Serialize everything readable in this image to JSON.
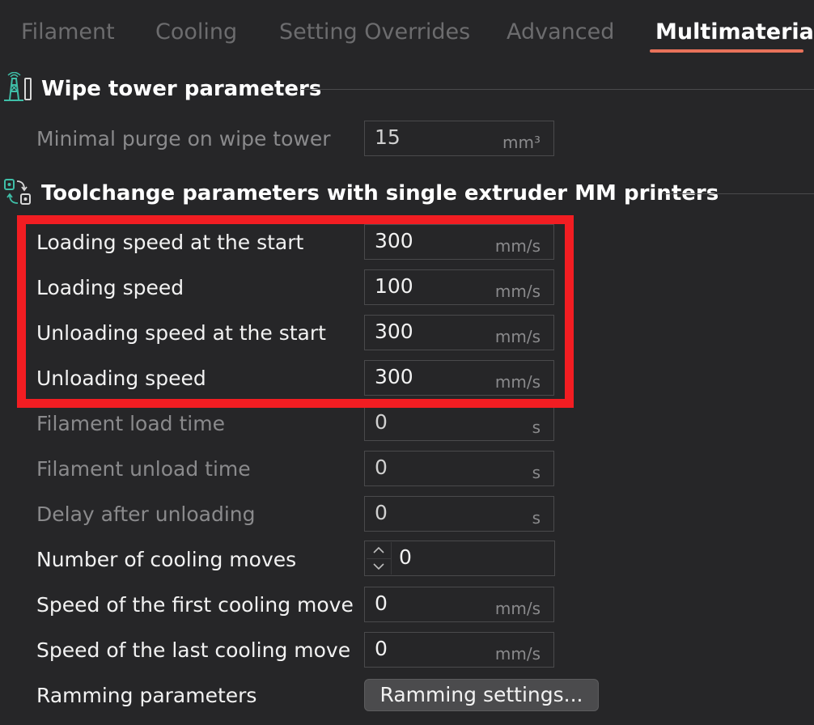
{
  "tabs": [
    {
      "label": "Filament",
      "active": false
    },
    {
      "label": "Cooling",
      "active": false
    },
    {
      "label": "Setting Overrides",
      "active": false
    },
    {
      "label": "Advanced",
      "active": false
    },
    {
      "label": "Multimaterial",
      "active": true
    }
  ],
  "sections": {
    "wipe_tower": {
      "title": "Wipe tower parameters",
      "icon": "wipe-tower-icon",
      "rows": [
        {
          "label": "Minimal purge on wipe tower",
          "value": "15",
          "unit": "mm³"
        }
      ]
    },
    "toolchange": {
      "title": "Toolchange parameters with single extruder MM printers",
      "icon": "toolchange-icon",
      "rows": [
        {
          "label": "Loading speed at the start",
          "value": "300",
          "unit": "mm/s"
        },
        {
          "label": "Loading speed",
          "value": "100",
          "unit": "mm/s"
        },
        {
          "label": "Unloading speed at the start",
          "value": "300",
          "unit": "mm/s"
        },
        {
          "label": "Unloading speed",
          "value": "300",
          "unit": "mm/s"
        },
        {
          "label": "Filament load time",
          "value": "0",
          "unit": "s"
        },
        {
          "label": "Filament unload time",
          "value": "0",
          "unit": "s"
        },
        {
          "label": "Delay after unloading",
          "value": "0",
          "unit": "s"
        },
        {
          "label": "Number of cooling moves",
          "value": "0"
        },
        {
          "label": "Speed of the first cooling move",
          "value": "0",
          "unit": "mm/s"
        },
        {
          "label": "Speed of the last cooling move",
          "value": "0",
          "unit": "mm/s"
        },
        {
          "label": "Ramming parameters",
          "button": "Ramming settings..."
        }
      ]
    }
  },
  "colors": {
    "background": "#262628",
    "accent": "#e8725a",
    "icon_teal": "#3fbfa8",
    "highlight": "#f21d22"
  }
}
